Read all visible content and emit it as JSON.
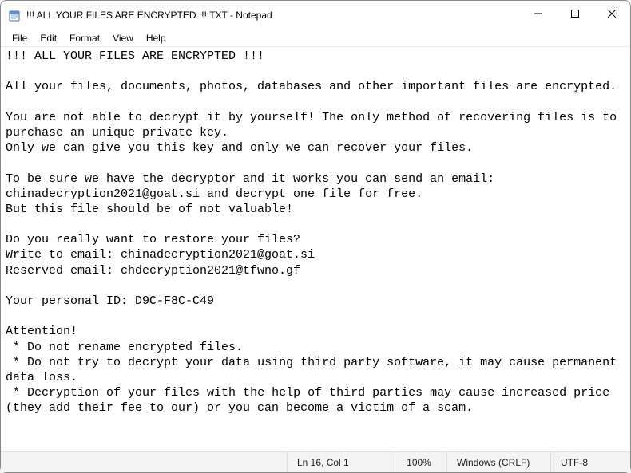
{
  "window": {
    "title": "!!! ALL YOUR FILES ARE ENCRYPTED !!!.TXT - Notepad"
  },
  "menu": {
    "file": "File",
    "edit": "Edit",
    "format": "Format",
    "view": "View",
    "help": "Help"
  },
  "content": {
    "text": "!!! ALL YOUR FILES ARE ENCRYPTED !!!\n\nAll your files, documents, photos, databases and other important files are encrypted.\n\nYou are not able to decrypt it by yourself! The only method of recovering files is to purchase an unique private key.\nOnly we can give you this key and only we can recover your files.\n\nTo be sure we have the decryptor and it works you can send an email: chinadecryption2021@goat.si and decrypt one file for free.\nBut this file should be of not valuable!\n\nDo you really want to restore your files?\nWrite to email: chinadecryption2021@goat.si\nReserved email: chdecryption2021@tfwno.gf\n\nYour personal ID: D9C-F8C-C49\n\nAttention!\n * Do not rename encrypted files.\n * Do not try to decrypt your data using third party software, it may cause permanent data loss.\n * Decryption of your files with the help of third parties may cause increased price (they add their fee to our) or you can become a victim of a scam."
  },
  "status": {
    "position": "Ln 16, Col 1",
    "zoom": "100%",
    "eol": "Windows (CRLF)",
    "encoding": "UTF-8"
  }
}
